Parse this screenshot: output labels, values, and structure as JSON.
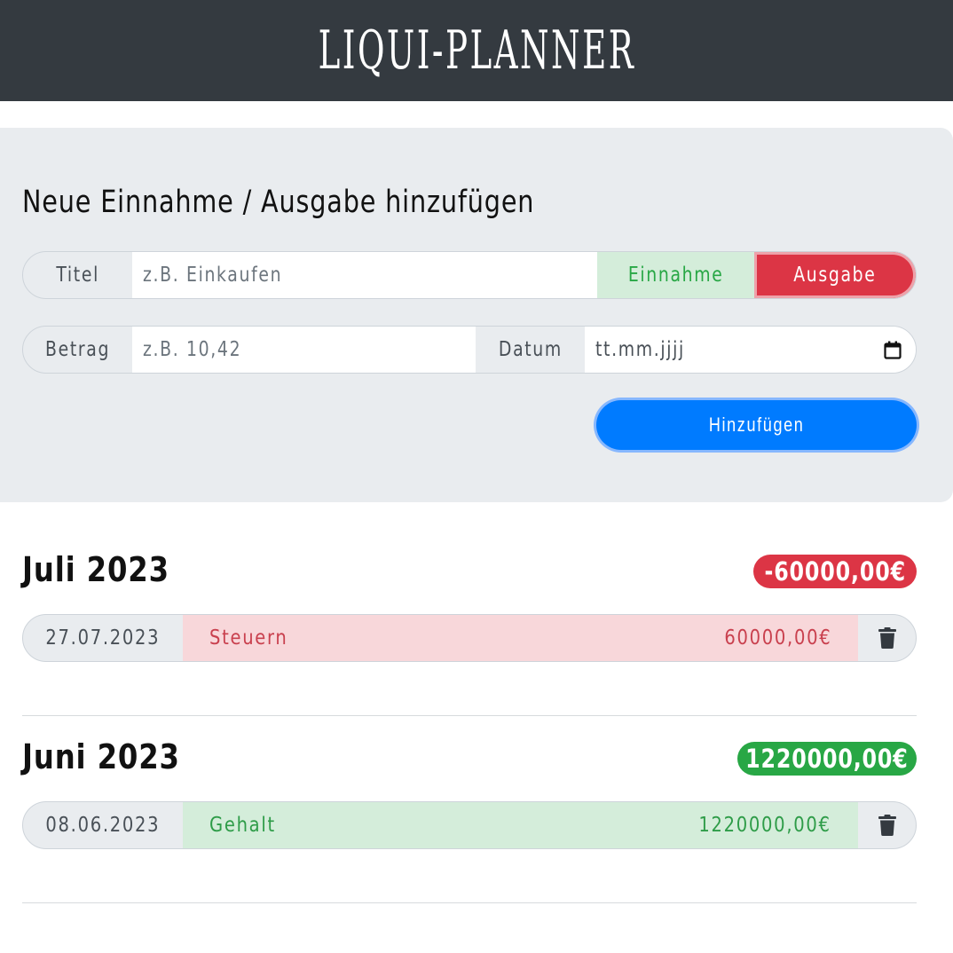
{
  "header": {
    "brand": "LIQUI-PLANNER"
  },
  "form": {
    "title": "Neue Einnahme / Ausgabe hinzufügen",
    "titel_label": "Titel",
    "titel_placeholder": "z.B. Einkaufen",
    "type_income": "Einnahme",
    "type_expense": "Ausgabe",
    "type_selected": "Ausgabe",
    "betrag_label": "Betrag",
    "betrag_placeholder": "z.B. 10,42",
    "datum_label": "Datum",
    "datum_placeholder": "tt.mm.jjjj",
    "submit_label": "Hinzufügen"
  },
  "months": [
    {
      "title": "Juli 2023",
      "balance": "-60000,00€",
      "balance_type": "negative",
      "entries": [
        {
          "date": "27.07.2023",
          "title": "Steuern",
          "amount": "60000,00€",
          "type": "expense"
        }
      ]
    },
    {
      "title": "Juni 2023",
      "balance": "1220000,00€",
      "balance_type": "positive",
      "entries": [
        {
          "date": "08.06.2023",
          "title": "Gehalt",
          "amount": "1220000,00€",
          "type": "income"
        }
      ]
    }
  ],
  "icons": {
    "calendar": "calendar-icon",
    "trash": "trash-icon"
  },
  "colors": {
    "header_bg": "#343a40",
    "panel_bg": "#e9ecef",
    "primary": "#007bff",
    "danger": "#dc3545",
    "success": "#28a745"
  }
}
